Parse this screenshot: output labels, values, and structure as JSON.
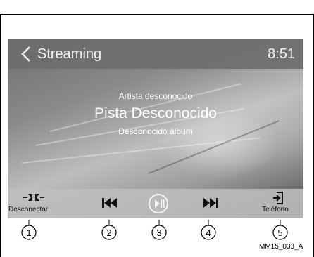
{
  "header": {
    "title": "Streaming",
    "time": "8:51"
  },
  "track": {
    "artist": "Artista desconocido",
    "title": "Pista Desconocido",
    "album": "Desconocido álbum"
  },
  "controls": {
    "disconnect_label": "Desconectar",
    "phone_label": "Teléfono"
  },
  "callouts": [
    "1",
    "2",
    "3",
    "4",
    "5"
  ],
  "reference_code": "MM15_033_A"
}
